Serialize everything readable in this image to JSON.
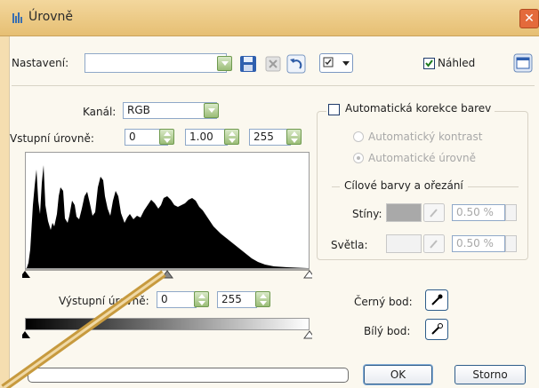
{
  "window": {
    "title": "Úrovně",
    "close_symbol": "✕"
  },
  "toolbar": {
    "preset_label": "Nastavení:",
    "preset_value": "",
    "preview_label": "Náhled",
    "preview_checked": true
  },
  "input_levels": {
    "channel_label": "Kanál:",
    "channel_value": "RGB",
    "input_label": "Vstupní úrovně:",
    "black": "0",
    "gamma": "1.00",
    "white": "255"
  },
  "output_levels": {
    "label": "Výstupní úrovně:",
    "black": "0",
    "white": "255"
  },
  "auto_panel": {
    "auto_color_label": "Automatická korekce barev",
    "auto_contrast_label": "Automatický kontrast",
    "auto_levels_label": "Automatické úrovně",
    "group_label": "Cílové barvy a ořezání",
    "shadows_label": "Stíny:",
    "shadows_value": "0.50 %",
    "highlights_label": "Světla:",
    "highlights_value": "0.50 %"
  },
  "pickers": {
    "black_point_label": "Černý bod:",
    "white_point_label": "Bílý bod:"
  },
  "buttons": {
    "ok": "OK",
    "cancel": "Storno"
  },
  "progress": {
    "value": 0
  },
  "icons": {
    "app": "levels-icon",
    "save": "save-icon",
    "delete": "delete-icon",
    "reset": "undo-icon",
    "options": "options-icon",
    "layout": "layout-icon",
    "eyedropper": "eyedropper-icon"
  }
}
